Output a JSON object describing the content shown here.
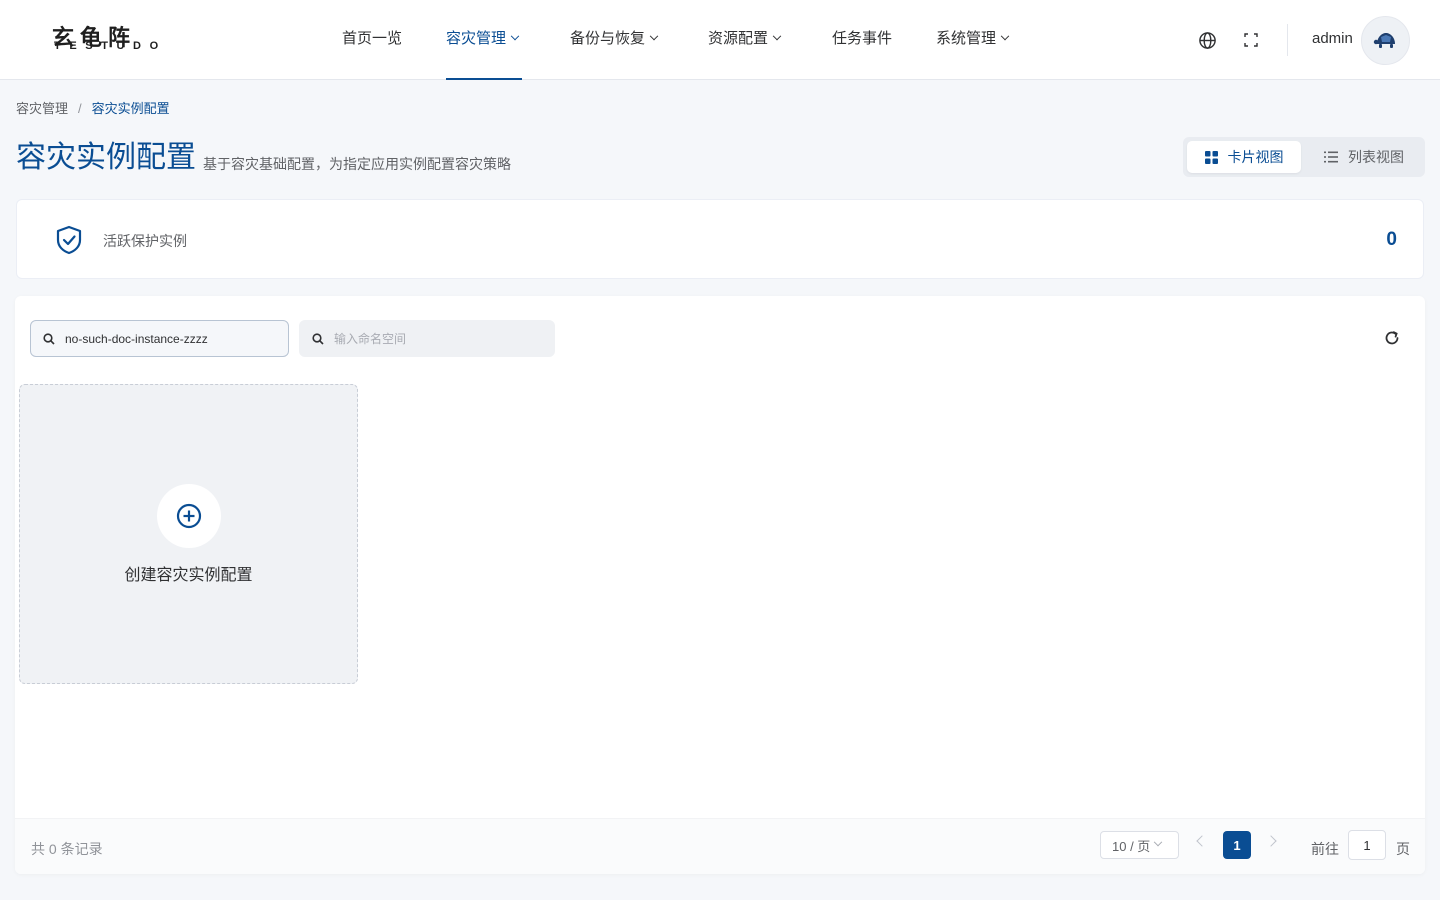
{
  "header": {
    "logo_cn": "玄龟阵",
    "logo_en": "TESTUDO",
    "nav": [
      {
        "label": "首页一览"
      },
      {
        "label": "容灾管理"
      },
      {
        "label": "备份与恢复"
      },
      {
        "label": "资源配置"
      },
      {
        "label": "任务事件"
      },
      {
        "label": "系统管理"
      }
    ],
    "active_nav": "容灾管理",
    "icons": [
      "globe-icon",
      "fullscreen-icon"
    ],
    "username": "admin"
  },
  "breadcrumb": {
    "parent": "容灾管理",
    "separator": "/",
    "current": "容灾实例配置"
  },
  "page": {
    "title": "容灾实例配置",
    "subtitle": "基于容灾基础配置，为指定应用实例配置容灾策略"
  },
  "view_switch": {
    "card_label": "卡片视图",
    "list_label": "列表视图",
    "selected": "卡片视图"
  },
  "stats": {
    "label": "活跃保护实例",
    "value": "0"
  },
  "filters": {
    "instance_value": "no-such-doc-instance-zzzz",
    "namespace_placeholder": "输入命名空间"
  },
  "create_card": {
    "label": "创建容灾实例配置"
  },
  "pagination": {
    "total_text": "共 0 条记录",
    "page_size": "10 / 页",
    "current_page": "1",
    "goto_label": "前往",
    "goto_value": "1",
    "goto_suffix": "页"
  },
  "colors": {
    "primary": "#0a4d93",
    "background": "#f5f7fa",
    "text": "#303133",
    "muted": "#909399"
  }
}
